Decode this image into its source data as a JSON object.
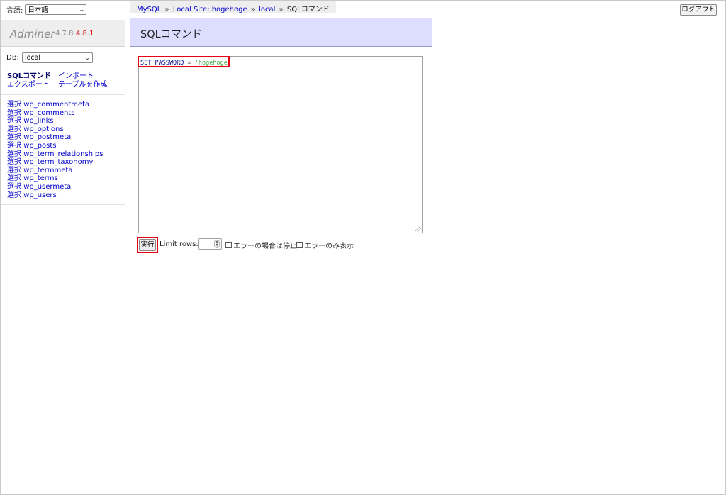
{
  "sidebar": {
    "lang_label": "言語:",
    "lang_selected": "日本語",
    "logo": {
      "name": "Adminer",
      "version": "4.7.8",
      "new_version": "4.8.1"
    },
    "db_label": "DB:",
    "db_selected": "local",
    "links": {
      "sql_command": "SQLコマンド",
      "import": "インポート",
      "export": "エクスポート",
      "create_table": "テーブルを作成"
    },
    "table_select_label": "選択",
    "tables": [
      "wp_commentmeta",
      "wp_comments",
      "wp_links",
      "wp_options",
      "wp_postmeta",
      "wp_posts",
      "wp_term_relationships",
      "wp_term_taxonomy",
      "wp_termmeta",
      "wp_terms",
      "wp_usermeta",
      "wp_users"
    ]
  },
  "breadcrumb": {
    "server": "MySQL",
    "site": "Local Site: hogehoge",
    "db": "local",
    "current": "SQLコマンド",
    "separator": "»"
  },
  "header": {
    "logout": "ログアウト"
  },
  "main": {
    "title": "SQLコマンド",
    "query": {
      "keyword": "SET PASSWORD",
      "operator": "=",
      "value": "'hogehoge'"
    },
    "execute_label": "実行",
    "limit_label": "Limit rows:",
    "limit_value": "",
    "stop_on_error": "エラーの場合は停止",
    "show_only_errors": "エラーのみ表示"
  },
  "colors": {
    "heading_bg": "#ddddff",
    "link": "#0000cc",
    "highlight_box": "#e60012",
    "sql_string": "#44aa44"
  }
}
